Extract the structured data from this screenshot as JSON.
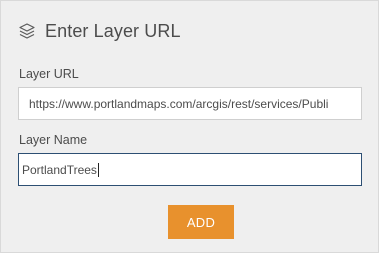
{
  "header": {
    "title": "Enter Layer URL",
    "icon": "layers-icon"
  },
  "form": {
    "url_label": "Layer URL",
    "url_value": "https://www.portlandmaps.com/arcgis/rest/services/Publi",
    "name_label": "Layer Name",
    "name_value": "PortlandTrees",
    "add_label": "ADD"
  },
  "colors": {
    "panel_background": "#efefef",
    "accent_button": "#e8912d",
    "focused_border": "#2d4f73",
    "text": "#4c4c4c"
  }
}
